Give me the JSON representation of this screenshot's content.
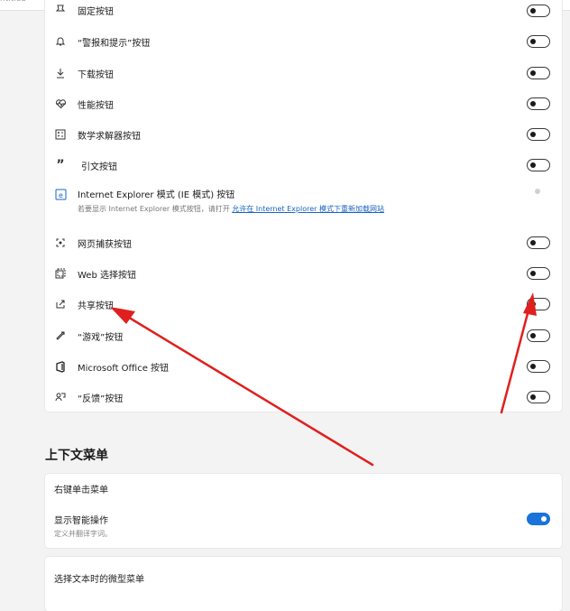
{
  "header": {
    "corner_text": "ntitled"
  },
  "toolbar_items": [
    {
      "label": "固定按钮",
      "icon": "pin-icon",
      "toggle": "off"
    },
    {
      "label": "“警报和提示”按钮",
      "icon": "bell-icon",
      "toggle": "off"
    },
    {
      "label": "下载按钮",
      "icon": "download-icon",
      "toggle": "off"
    },
    {
      "label": "性能按钮",
      "icon": "heart-pulse-icon",
      "toggle": "off"
    },
    {
      "label": "数学求解器按钮",
      "icon": "math-solver-icon",
      "toggle": "off"
    },
    {
      "label": "引文按钮",
      "icon": "quote-icon",
      "toggle": "off"
    },
    {
      "label": "Internet Explorer 模式 (IE 模式) 按钮",
      "icon": "ie-mode-icon",
      "toggle": "disabled",
      "sub_text": "若要显示 Internet Explorer 模式按钮，请打开",
      "sub_link": "允许在 Internet Explorer 模式下重新加载网站"
    },
    {
      "label": "网页捕获按钮",
      "icon": "web-capture-icon",
      "toggle": "off"
    },
    {
      "label": "Web 选择按钮",
      "icon": "web-select-icon",
      "toggle": "off"
    },
    {
      "label": "共享按钮",
      "icon": "share-icon",
      "toggle": "off"
    },
    {
      "label": "“游戏”按钮",
      "icon": "game-icon",
      "toggle": "off"
    },
    {
      "label": "Microsoft Office 按钮",
      "icon": "office-icon",
      "toggle": "off"
    },
    {
      "label": "“反馈”按钮",
      "icon": "feedback-icon",
      "toggle": "off"
    }
  ],
  "context_menu": {
    "title": "上下文菜单",
    "right_click_header": "右键单击菜单",
    "smart_actions_label": "显示智能操作",
    "smart_actions_desc": "定义并翻译字词。",
    "smart_actions_toggle": "on",
    "mini_menu_label": "选择文本时的微型菜单"
  },
  "colors": {
    "accent": "#1a73d9",
    "annotation_arrow": "#e0201e"
  }
}
